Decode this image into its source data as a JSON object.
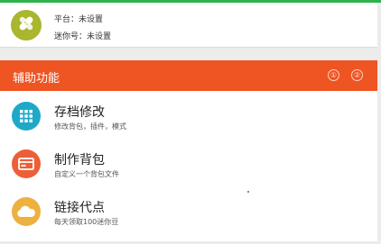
{
  "profile": {
    "platform_text": "平台：未设置",
    "mini_id_text": "迷你号：未设置",
    "avatar_color": "#a9b62e"
  },
  "section": {
    "title": "辅助功能",
    "button_1": "①",
    "button_2": "②",
    "bar_color": "#ef5423"
  },
  "items": [
    {
      "title": "存档修改",
      "subtitle": "修改背包，插件，模式",
      "icon": "grid-icon",
      "icon_color": "#1fa9c9"
    },
    {
      "title": "制作背包",
      "subtitle": "自定义一个背包文件",
      "icon": "card-icon",
      "icon_color": "#ec5f37"
    },
    {
      "title": "链接代点",
      "subtitle": "每天领取100迷你豆",
      "icon": "cloud-icon",
      "icon_color": "#eeb03f"
    }
  ]
}
